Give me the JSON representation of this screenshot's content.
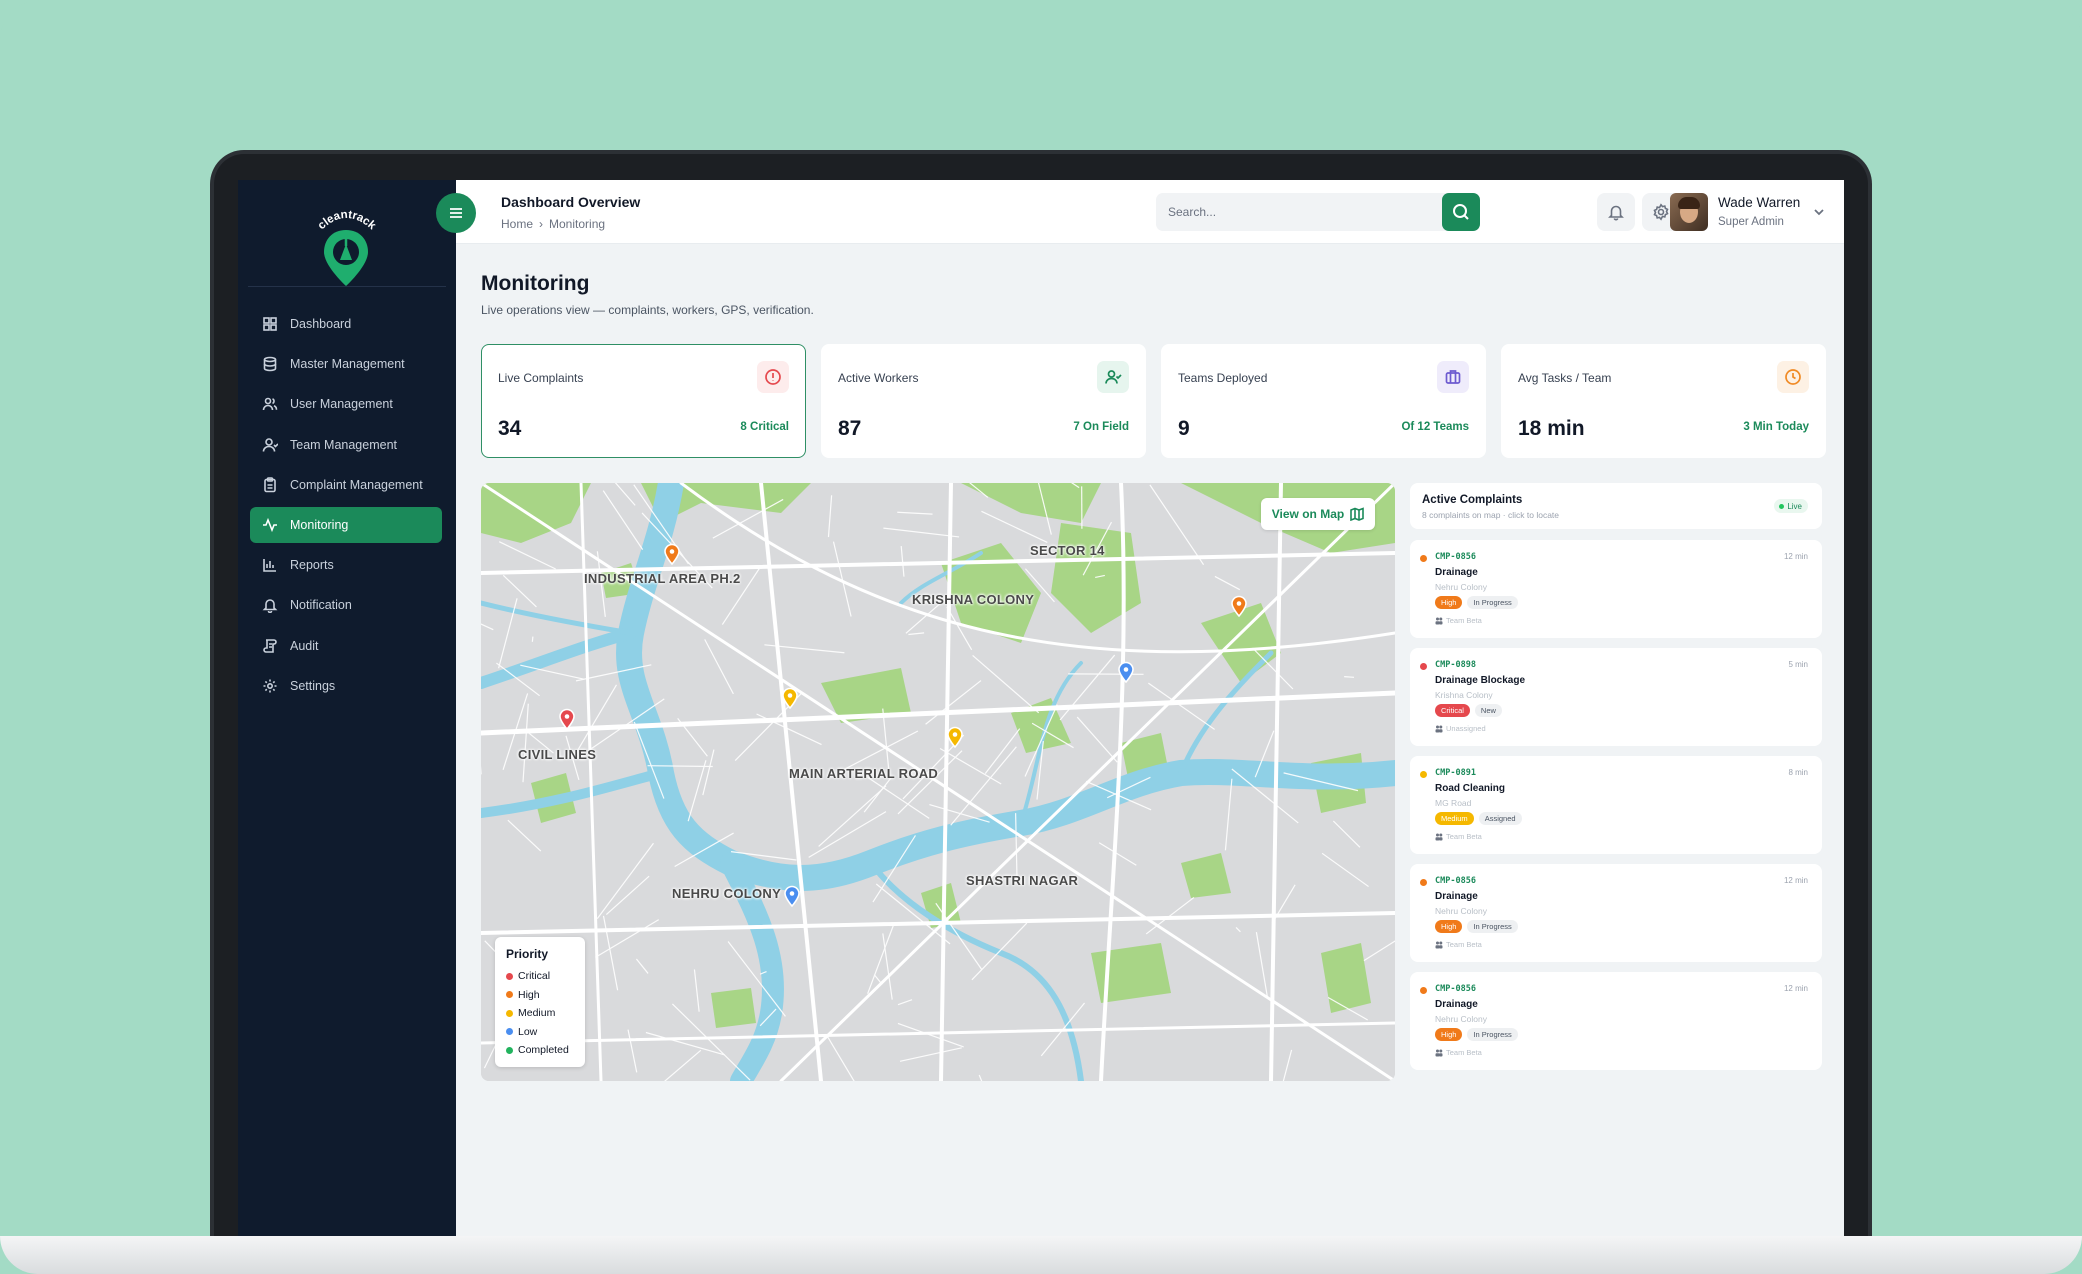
{
  "brand": {
    "name": "cleantrack",
    "accent": "#1b8a5a"
  },
  "sidebar": {
    "items": [
      {
        "label": "Dashboard",
        "icon": "grid-icon",
        "active": false
      },
      {
        "label": "Master Management",
        "icon": "database-icon",
        "active": false
      },
      {
        "label": "User Management",
        "icon": "users-icon",
        "active": false
      },
      {
        "label": "Team Management",
        "icon": "team-icon",
        "active": false
      },
      {
        "label": "Complaint Management",
        "icon": "clipboard-icon",
        "active": false
      },
      {
        "label": "Monitoring",
        "icon": "activity-icon",
        "active": true
      },
      {
        "label": "Reports",
        "icon": "bar-chart-icon",
        "active": false
      },
      {
        "label": "Notification",
        "icon": "bell-icon",
        "active": false
      },
      {
        "label": "Audit",
        "icon": "scroll-icon",
        "active": false
      },
      {
        "label": "Settings",
        "icon": "gear-icon",
        "active": false
      }
    ]
  },
  "header": {
    "title": "Dashboard Overview",
    "breadcrumb": [
      "Home",
      "Monitoring"
    ],
    "search_placeholder": "Search...",
    "user": {
      "name": "Wade Warren",
      "role": "Super Admin"
    }
  },
  "page": {
    "title": "Monitoring",
    "subtitle": "Live operations view — complaints, workers, GPS, verification."
  },
  "stats": [
    {
      "label": "Live Complaints",
      "value": "34",
      "note": "8 Critical",
      "icon": "alert-circle-icon",
      "color": "#e5484d"
    },
    {
      "label": "Active Workers",
      "value": "87",
      "note": "7 On Field",
      "icon": "user-check-icon",
      "color": "#1b8a5a"
    },
    {
      "label": "Teams Deployed",
      "value": "9",
      "note": "Of 12 Teams",
      "icon": "briefcase-icon",
      "color": "#6d5bd0"
    },
    {
      "label": "Avg Tasks / Team",
      "value": "18 min",
      "note": "3 Min Today",
      "icon": "clock-icon",
      "color": "#f08a24"
    }
  ],
  "map": {
    "view_button": "View on Map",
    "labels": [
      "INDUSTRIAL AREA PH.2",
      "SECTOR 14",
      "KRISHNA COLONY",
      "CIVIL LINES",
      "MAIN ARTERIAL ROAD",
      "SHASTRI NAGAR",
      "NEHRU COLONY"
    ],
    "legend": {
      "title": "Priority",
      "items": [
        {
          "label": "Critical",
          "color": "#e5484d"
        },
        {
          "label": "High",
          "color": "#f07a1a"
        },
        {
          "label": "Medium",
          "color": "#f5b800"
        },
        {
          "label": "Low",
          "color": "#4a8ef0"
        },
        {
          "label": "Completed",
          "color": "#22b35e"
        }
      ]
    },
    "pins": [
      {
        "priority": "High"
      },
      {
        "priority": "High"
      },
      {
        "priority": "Critical"
      },
      {
        "priority": "Medium"
      },
      {
        "priority": "Medium"
      },
      {
        "priority": "Low"
      },
      {
        "priority": "Low"
      }
    ]
  },
  "panel": {
    "title": "Active Complaints",
    "subtitle": "8 complaints on map · click to locate",
    "live": "Live",
    "complaints": [
      {
        "id": "CMP-0856",
        "time": "12 min",
        "title": "Drainage",
        "location": "Nehru Colony",
        "priority": "High",
        "priority_color": "#f07a1a",
        "status": "In Progress",
        "team": "Team Beta"
      },
      {
        "id": "CMP-0898",
        "time": "5 min",
        "title": "Drainage Blockage",
        "location": "Krishna Colony",
        "priority": "Critical",
        "priority_color": "#e5484d",
        "status": "New",
        "team": "Unassigned"
      },
      {
        "id": "CMP-0891",
        "time": "8 min",
        "title": "Road Cleaning",
        "location": "MG Road",
        "priority": "Medium",
        "priority_color": "#f5b800",
        "status": "Assigned",
        "team": "Team Beta"
      },
      {
        "id": "CMP-0856",
        "time": "12 min",
        "title": "Drainage",
        "location": "Nehru Colony",
        "priority": "High",
        "priority_color": "#f07a1a",
        "status": "In Progress",
        "team": "Team Beta"
      },
      {
        "id": "CMP-0856",
        "time": "12 min",
        "title": "Drainage",
        "location": "Nehru Colony",
        "priority": "High",
        "priority_color": "#f07a1a",
        "status": "In Progress",
        "team": "Team Beta"
      }
    ]
  }
}
